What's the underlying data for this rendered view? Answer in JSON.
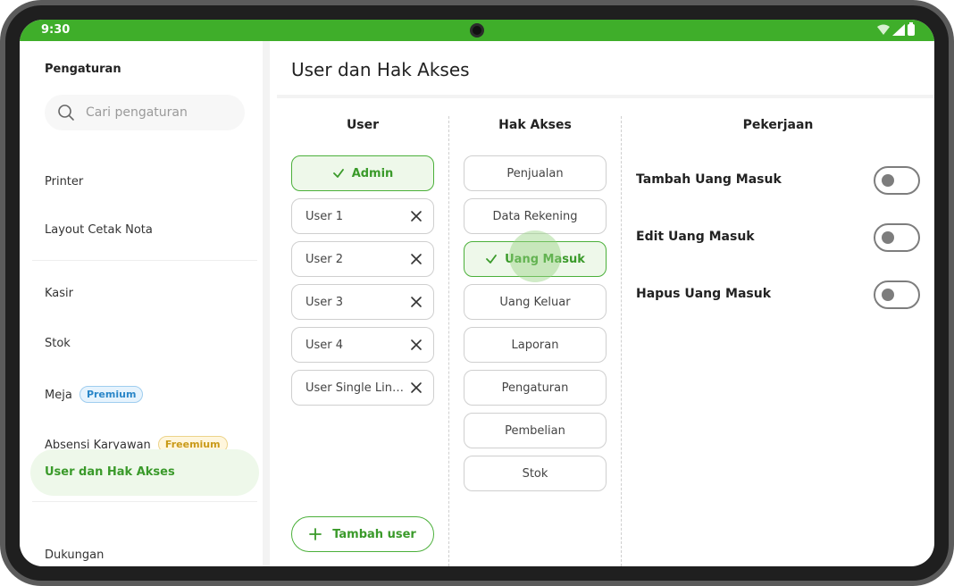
{
  "status_bar": {
    "time": "9:30"
  },
  "sidebar": {
    "title": "Pengaturan",
    "search_placeholder": "Cari pengaturan",
    "items": [
      {
        "label": "Printer"
      },
      {
        "label": "Layout Cetak Nota"
      },
      {
        "label": "Kasir"
      },
      {
        "label": "Stok"
      },
      {
        "label": "Meja",
        "badge": "Premium"
      },
      {
        "label": "Absensi Karyawan",
        "badge": "Freemium"
      },
      {
        "label": "User dan Hak Akses",
        "active": true
      },
      {
        "label": "Dukungan"
      }
    ]
  },
  "header": {
    "title": "User dan Hak Akses"
  },
  "columns": {
    "user": "User",
    "hak_akses": "Hak Akses",
    "pekerjaan": "Pekerjaan"
  },
  "users": [
    {
      "label": "Admin",
      "selected": true
    },
    {
      "label": "User 1"
    },
    {
      "label": "User 2"
    },
    {
      "label": "User 3"
    },
    {
      "label": "User 4"
    },
    {
      "label": "User Single Line..."
    }
  ],
  "add_user_label": "Tambah user",
  "access": [
    {
      "label": "Penjualan"
    },
    {
      "label": "Data Rekening"
    },
    {
      "label": "Uang Masuk",
      "selected": true
    },
    {
      "label": "Uang Keluar"
    },
    {
      "label": "Laporan"
    },
    {
      "label": "Pengaturan"
    },
    {
      "label": "Pembelian"
    },
    {
      "label": "Stok"
    }
  ],
  "permissions": [
    {
      "label": "Tambah Uang Masuk",
      "enabled": false
    },
    {
      "label": "Edit Uang Masuk",
      "enabled": false
    },
    {
      "label": "Hapus Uang Masuk",
      "enabled": false
    }
  ],
  "colors": {
    "accent": "#3fae2a",
    "accent_light": "#eef8ea",
    "premium": "#2a86c8",
    "freemium": "#c99a18"
  }
}
